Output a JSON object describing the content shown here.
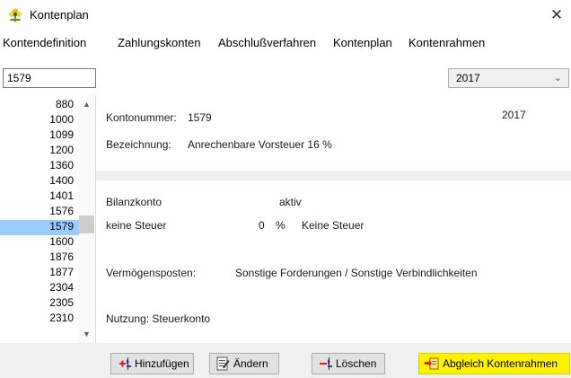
{
  "window": {
    "title": "Kontenplan",
    "close_glyph": "✕"
  },
  "menu": [
    {
      "label": "Kontendefinition"
    },
    {
      "label": "Zahlungskonten"
    },
    {
      "label": "Abschlußverfahren"
    },
    {
      "label": "Kontenplan"
    },
    {
      "label": "Kontenrahmen"
    }
  ],
  "search": {
    "value": "1579"
  },
  "year_select": {
    "selected": "2017"
  },
  "account_list": {
    "items": [
      "880",
      "1000",
      "1099",
      "1200",
      "1360",
      "1400",
      "1401",
      "1576",
      "1579",
      "1600",
      "1876",
      "1877",
      "2304",
      "2305",
      "2310"
    ],
    "selected": "1579"
  },
  "details": {
    "kontonummer_label": "Kontonummer:",
    "kontonummer_value": "1579",
    "year": "2017",
    "bezeichnung_label": "Bezeichnung:",
    "bezeichnung_value": "Anrechenbare Vorsteuer 16 %",
    "kontoart": "Bilanzkonto",
    "status": "aktiv",
    "steuer_label": "keine Steuer",
    "steuer_satz": "0",
    "steuer_prozent": "%",
    "steuer_text": "Keine Steuer",
    "vermoegen_label": "Vermögensposten:",
    "vermoegen_value": "Sonstige Forderungen / Sonstige Verbindlichkeiten",
    "nutzung": "Nutzung: Steuerkonto"
  },
  "buttons": {
    "add": "Hinzufügen",
    "edit": "Ändern",
    "delete": "Löschen",
    "sync": "Abgleich Kontenrahmen"
  },
  "colors": {
    "selection": "#99ccff",
    "highlight": "#fff200",
    "button_face": "#e1e1e1",
    "panel": "#f0f0f0"
  }
}
